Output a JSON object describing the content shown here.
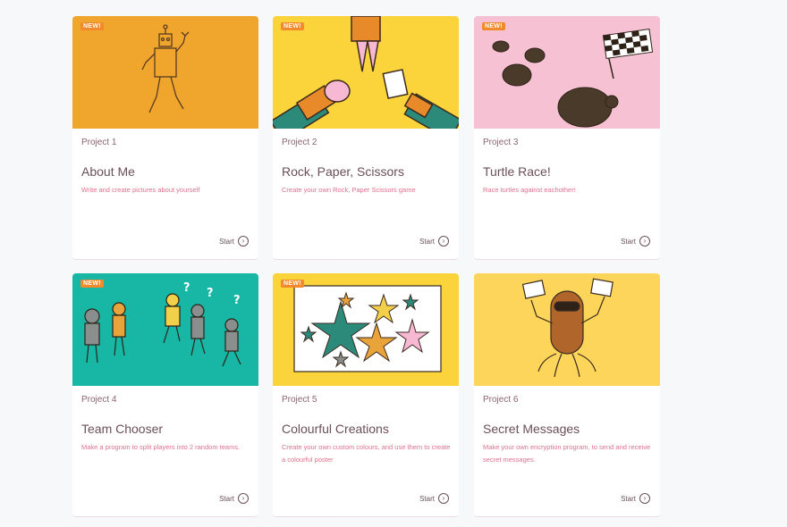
{
  "colors": {
    "badge": "#f08a2a",
    "accent_text": "#e0708f",
    "title_text": "#6b4f58"
  },
  "cards": [
    {
      "badge": "NEW!",
      "number": "Project 1",
      "title": "About Me",
      "description": "Write and create pictures about yourself",
      "start_label": "Start",
      "start_icon": "chevron-circle-right-icon",
      "banner_color": "#f0a52c"
    },
    {
      "badge": "NEW!",
      "number": "Project 2",
      "title": "Rock, Paper, Scissors",
      "description": "Create your own Rock, Paper Scissors game",
      "start_label": "Start",
      "start_icon": "chevron-circle-right-icon",
      "banner_color": "#fbd33a"
    },
    {
      "badge": "NEW!",
      "number": "Project 3",
      "title": "Turtle Race!",
      "description": "Race turtles against eachother!",
      "start_label": "Start",
      "start_icon": "chevron-circle-right-icon",
      "banner_color": "#f6c1d2"
    },
    {
      "badge": "NEW!",
      "number": "Project 4",
      "title": "Team Chooser",
      "description": "Make a program to split players into 2 random teams.",
      "start_label": "Start",
      "start_icon": "chevron-circle-right-icon",
      "banner_color": "#17b6a5"
    },
    {
      "badge": "NEW!",
      "number": "Project 5",
      "title": "Colourful Creations",
      "description": "Create your own custom colours, and use them to create a colourful poster",
      "start_label": "Start",
      "start_icon": "chevron-circle-right-icon",
      "banner_color": "#fbd33a"
    },
    {
      "badge": "",
      "number": "Project 6",
      "title": "Secret Messages",
      "description": "Make your own encryption program, to send and receive secret messages.",
      "start_label": "Start",
      "start_icon": "chevron-circle-right-icon",
      "banner_color": "#fcd55a"
    }
  ]
}
